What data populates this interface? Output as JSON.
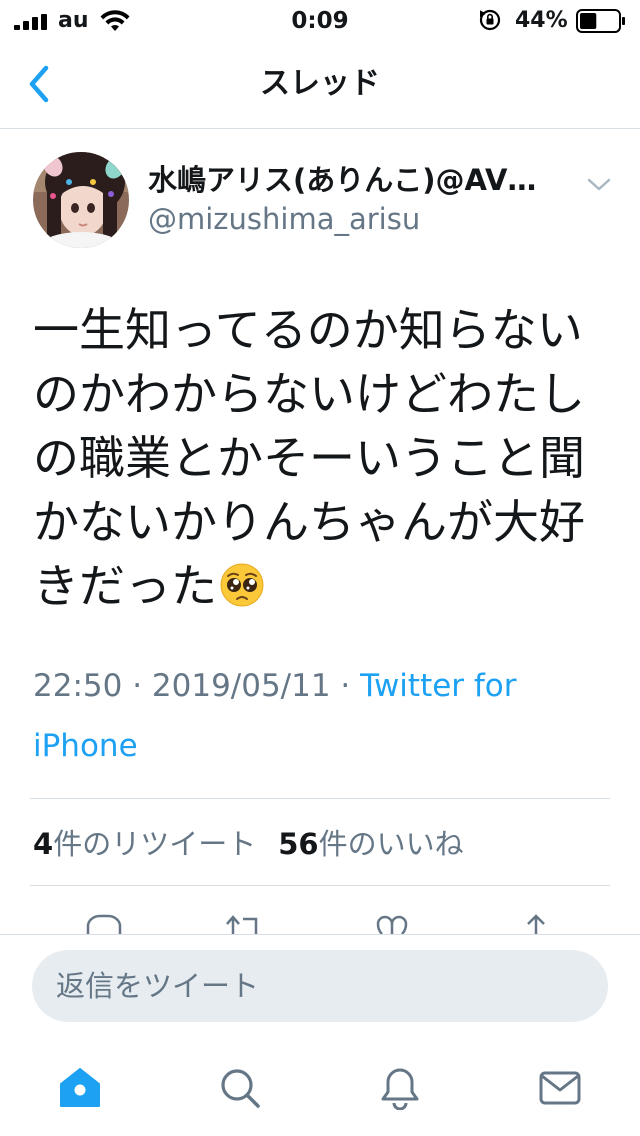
{
  "status_bar": {
    "carrier": "au",
    "time": "0:09",
    "battery_percent": "44%",
    "battery_level": 0.44
  },
  "nav": {
    "title": "スレッド",
    "back_icon": "chevron-left-icon"
  },
  "tweet": {
    "display_name": "水嶋アリス(ありんこ)@AV…",
    "username": "@mizushima_arisu",
    "text": "一生知ってるのか知らないのかわからないけどわたしの職業とかそーいうこと聞かないかりんちゃんが大好きだった",
    "emoji": "pleading-face-icon",
    "timestamp": "22:50 · 2019/05/11 · ",
    "source": "Twitter for iPhone",
    "retweet_count": "4",
    "retweet_label": "件のリツイート",
    "like_count": "56",
    "like_label": "件のいいね"
  },
  "actions": [
    "reply-icon",
    "retweet-icon",
    "like-icon",
    "share-icon"
  ],
  "reply": {
    "placeholder": "返信をツイート"
  },
  "tab_bar": {
    "tabs": [
      "home-icon",
      "search-icon",
      "notifications-icon",
      "messages-icon"
    ]
  },
  "colors": {
    "accent": "#1da1f2",
    "secondary_text": "#657786",
    "primary_text": "#14171a",
    "divider": "#d8dfe5",
    "input_bg": "#e6ecf0"
  }
}
